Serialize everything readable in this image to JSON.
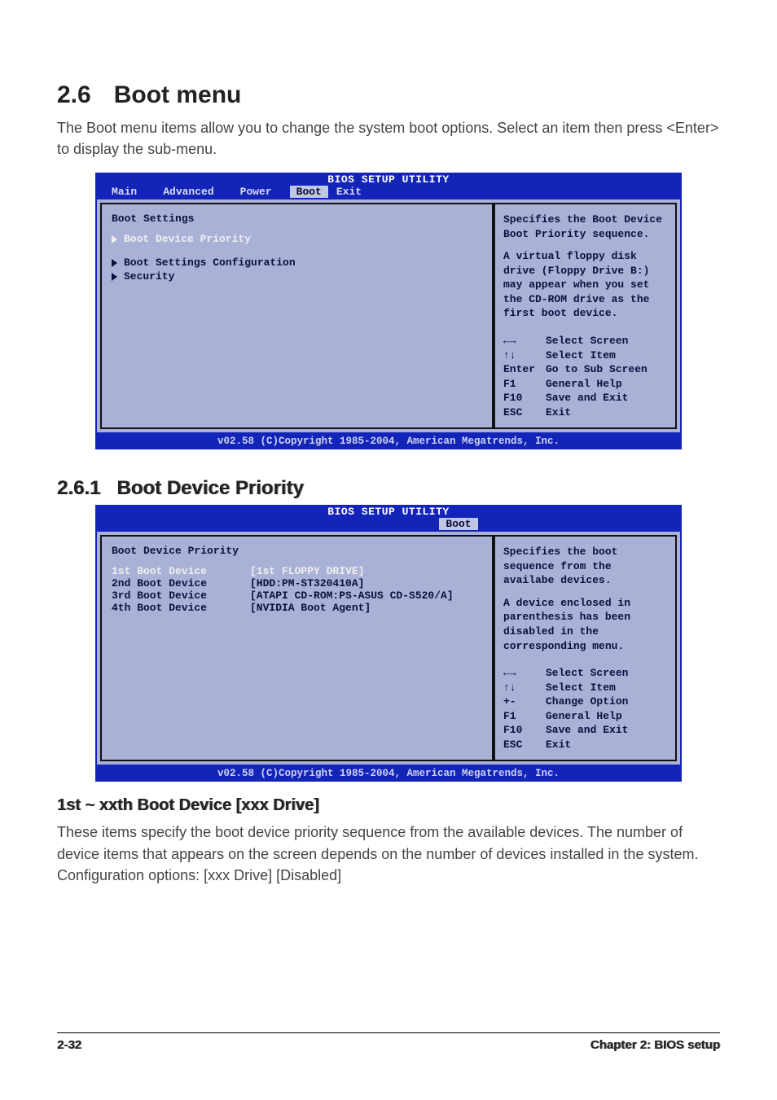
{
  "section": {
    "num": "2.6",
    "title": "Boot menu",
    "intro": "The Boot menu items allow you to change the system boot options. Select an item then press <Enter> to display the sub-menu."
  },
  "bios1": {
    "title": "BIOS SETUP UTILITY",
    "tabs": {
      "main": "Main",
      "advanced": "Advanced",
      "power": "Power",
      "boot": "Boot",
      "exit": "Exit"
    },
    "left": {
      "heading": "Boot Settings",
      "item1": "Boot Device Priority",
      "item2": "Boot Settings Configuration",
      "item3": "Security"
    },
    "help_top": "Specifies the Boot Device Boot Priority sequence.",
    "help_mid": "A virtual floppy disk drive (Floppy Drive B:) may appear when you set the CD-ROM drive as the first boot device.",
    "keys": {
      "lr": "Select Screen",
      "ud": "Select Item",
      "enter_k": "Enter",
      "enter_v": "Go to Sub Screen",
      "f1_k": "F1",
      "f1_v": "General Help",
      "f10_k": "F10",
      "f10_v": "Save and Exit",
      "esc_k": "ESC",
      "esc_v": "Exit"
    },
    "footer": "v02.58 (C)Copyright 1985-2004, American Megatrends, Inc."
  },
  "subsection": {
    "num": "2.6.1",
    "title": "Boot Device Priority"
  },
  "bios2": {
    "title": "BIOS SETUP UTILITY",
    "tab_boot": "Boot",
    "heading": "Boot Device Priority",
    "row1": {
      "k": "1st Boot Device",
      "v": "[1st FLOPPY DRIVE]"
    },
    "row2": {
      "k": "2nd Boot Device",
      "v": "[HDD:PM-ST320410A]"
    },
    "row3": {
      "k": "3rd Boot Device",
      "v": "[ATAPI CD-ROM:PS-ASUS CD-S520/A]"
    },
    "row4": {
      "k": "4th Boot Device",
      "v": "[NVIDIA Boot Agent]"
    },
    "help_top": "Specifies the boot sequence from the availabe devices.",
    "help_mid": "A device enclosed in parenthesis has been disabled in the corresponding menu.",
    "keys": {
      "lr": "Select Screen",
      "ud": "Select Item",
      "pm_k": "+-",
      "pm_v": "Change Option",
      "f1_k": "F1",
      "f1_v": "General Help",
      "f10_k": "F10",
      "f10_v": "Save and Exit",
      "esc_k": "ESC",
      "esc_v": "Exit"
    },
    "footer": "v02.58 (C)Copyright 1985-2004, American Megatrends, Inc."
  },
  "subsub": {
    "title": "1st ~ xxth Boot Device [xxx Drive]",
    "p1": "These items specify the boot device priority sequence from the available devices. The number of device items that appears on the screen depends on the number of devices installed in the system.",
    "p2": "Configuration options: [xxx Drive] [Disabled]"
  },
  "footer": {
    "left": "2-32",
    "right": "Chapter 2: BIOS setup"
  }
}
